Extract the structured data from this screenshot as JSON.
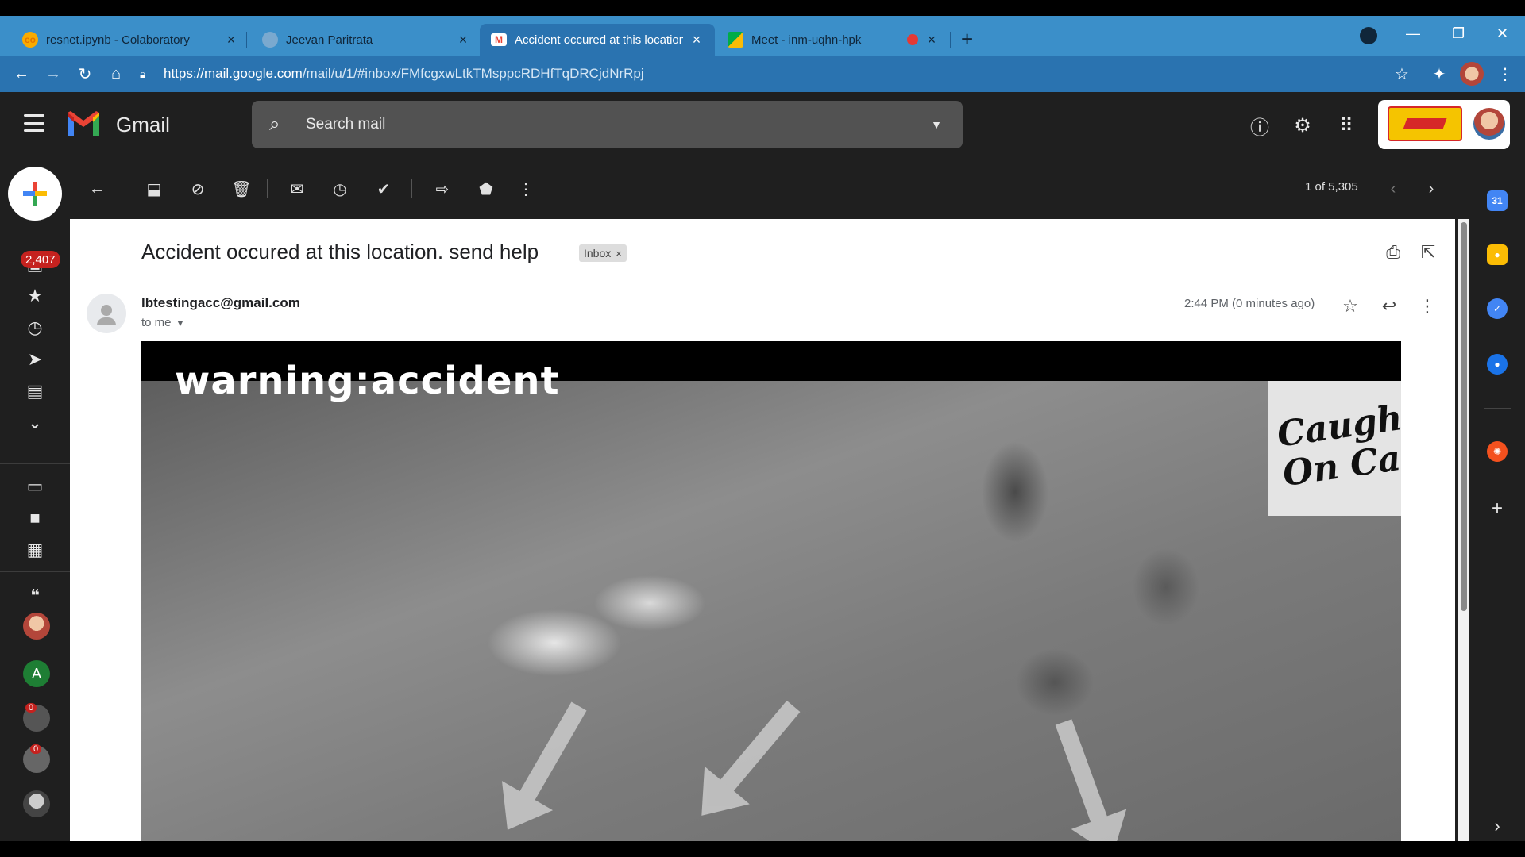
{
  "browser": {
    "tabs": [
      {
        "title": "resnet.ipynb - Colaboratory",
        "active": false
      },
      {
        "title": "Jeevan Paritrata",
        "active": false
      },
      {
        "title": "Accident occured at this location.",
        "active": true
      },
      {
        "title": "Meet - inm-uqhn-hpk",
        "active": false
      }
    ],
    "url_host": "https://mail.google.com",
    "url_path": "/mail/u/1/#inbox/FMfcgxwLtkTMsppcRDHfTqDRCjdNrRpj"
  },
  "gmail": {
    "app_name": "Gmail",
    "search_placeholder": "Search mail",
    "unread_count": "2,407",
    "pager": "1 of 5,305",
    "chat_badges": [
      "0",
      "0"
    ]
  },
  "message": {
    "subject": "Accident occured at this location. send help",
    "label_chip": "Inbox",
    "sender": "lbtestingacc@gmail.com",
    "recipient": "to me",
    "time": "2:44 PM (0 minutes ago)",
    "video_overlay": "warning:accident",
    "video_watermark_line1": "Caught",
    "video_watermark_line2": "On Cam"
  },
  "colors": {
    "tab_strip": "#3b8fc9",
    "active_tab": "#2a73b0",
    "gmail_dark": "#1f1f1f",
    "badge_red": "#c5221f"
  },
  "icons": {
    "message_toolbar": [
      "back-arrow-icon",
      "archive-icon",
      "report-spam-icon",
      "delete-icon",
      "mark-unread-icon",
      "snooze-icon",
      "add-to-tasks-icon",
      "move-to-icon",
      "label-icon",
      "more-vertical-icon"
    ],
    "side_apps": [
      "calendar-icon",
      "keep-icon",
      "tasks-icon",
      "contacts-icon",
      "addon-icon",
      "add-icon"
    ]
  }
}
